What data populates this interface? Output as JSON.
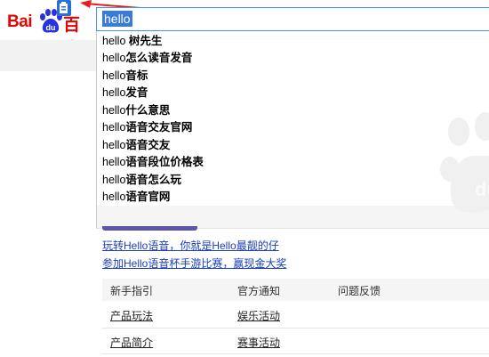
{
  "logo": {
    "text_bai": "Bai",
    "text_baidu": "百度",
    "du_glyph": "du"
  },
  "search": {
    "query": "hello"
  },
  "suggestions": [
    {
      "prefix": "hello ",
      "suffix": "树先生"
    },
    {
      "prefix": "hello",
      "suffix": "怎么读音发音"
    },
    {
      "prefix": "hello",
      "suffix": "音标"
    },
    {
      "prefix": "hello",
      "suffix": "发音"
    },
    {
      "prefix": "hello",
      "suffix": "什么意思"
    },
    {
      "prefix": "hello",
      "suffix": "语音交友官网"
    },
    {
      "prefix": "hello",
      "suffix": "语音交友"
    },
    {
      "prefix": "hello",
      "suffix": "语音段位价格表"
    },
    {
      "prefix": "hello",
      "suffix": "语音怎么玩"
    },
    {
      "prefix": "hello",
      "suffix": "语音官网"
    }
  ],
  "promo_links": [
    "玩转Hello语音，你就是Hello最靓的仔",
    "参加Hello语音杯手游比赛，赢现金大奖"
  ],
  "table": {
    "headers": [
      "新手指引",
      "官方通知",
      "问题反馈"
    ],
    "rows": [
      [
        "产品玩法",
        "娱乐活动"
      ],
      [
        "产品简介",
        "赛事活动"
      ]
    ]
  },
  "colors": {
    "baidu_red": "#e10601",
    "baidu_blue": "#2932e1",
    "link_blue": "#1a3fb8",
    "focus_blue": "#4791ff",
    "annotation_red": "#e02020"
  },
  "icons": {
    "logo_paw": "paw-icon",
    "annotation_chip": "bookmark-chip-icon",
    "annotation_arrow": "red-arrow-icon"
  }
}
